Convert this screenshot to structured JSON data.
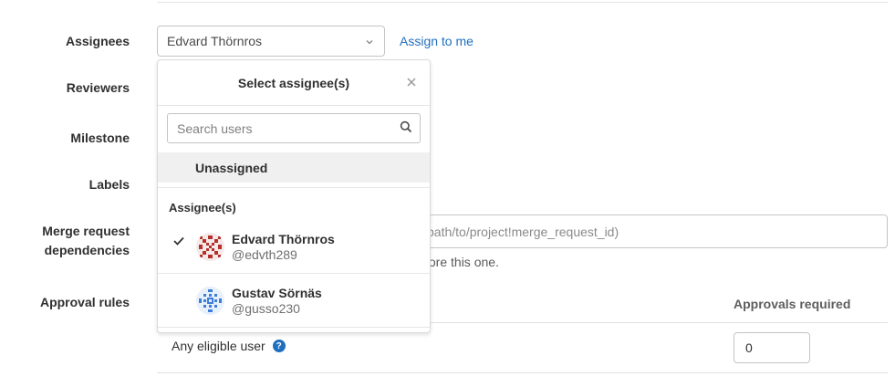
{
  "labels": {
    "assignees": "Assignees",
    "reviewers": "Reviewers",
    "milestone": "Milestone",
    "labels": "Labels",
    "mr_deps_line1": "Merge request",
    "mr_deps_line2": "dependencies",
    "approval_rules": "Approval rules"
  },
  "assignee_select": {
    "value": "Edvard Thörnros",
    "icon": "chevron-down-icon"
  },
  "assign_to_me": "Assign to me",
  "mr_dependencies": {
    "placeholder_visible": "path/to/project!merge_request_id)",
    "help_visible": "fore this one."
  },
  "approvals": {
    "header": "Approvals required",
    "rule_name": "Any eligible user",
    "help_icon": "?",
    "required_value": "0"
  },
  "dropdown": {
    "title": "Select assignee(s)",
    "close_icon": "close-icon",
    "search_placeholder": "Search users",
    "search_icon": "search-icon",
    "unassigned": "Unassigned",
    "section_title": "Assignee(s)",
    "users": [
      {
        "name": "Edvard Thörnros",
        "handle": "@edvth289",
        "selected": true,
        "avatar_color": "#b5302a"
      },
      {
        "name": "Gustav Sörnäs",
        "handle": "@gusso230",
        "selected": false,
        "avatar_color": "#3d7ed8"
      }
    ]
  },
  "colors": {
    "link": "#1f6fbf",
    "help": "#1f6fbf",
    "highlight": "#f0f0f0"
  }
}
